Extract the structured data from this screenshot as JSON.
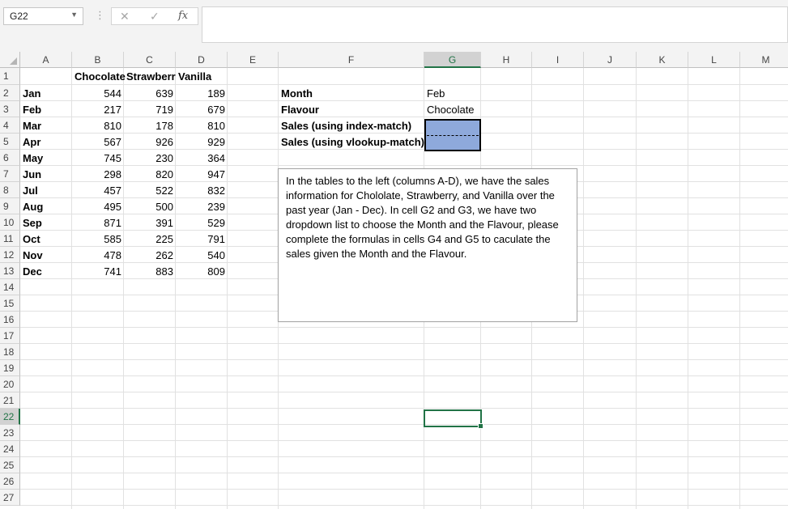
{
  "namebox": {
    "value": "G22",
    "dropdown_icon": "chevron-down-icon"
  },
  "formula_bar": {
    "cancel_icon": "cancel-x-icon",
    "confirm_icon": "checkmark-icon",
    "fx_label": "fx",
    "formula": ""
  },
  "columns": [
    "A",
    "B",
    "C",
    "D",
    "E",
    "F",
    "G",
    "H",
    "I",
    "J",
    "K",
    "L",
    "M"
  ],
  "selected_column": "G",
  "rows": [
    "1",
    "2",
    "3",
    "4",
    "5",
    "6",
    "7",
    "8",
    "9",
    "10",
    "11",
    "12",
    "13",
    "14",
    "15",
    "16",
    "17",
    "18",
    "19",
    "20",
    "21",
    "22",
    "23",
    "24",
    "25",
    "26",
    "27"
  ],
  "selected_row": "22",
  "table": {
    "headers": [
      "Chocolate",
      "Strawberr",
      "Vanilla"
    ],
    "months": [
      "Jan",
      "Feb",
      "Mar",
      "Apr",
      "May",
      "Jun",
      "Jul",
      "Aug",
      "Sep",
      "Oct",
      "Nov",
      "Dec"
    ],
    "values": [
      [
        544,
        639,
        189
      ],
      [
        217,
        719,
        679
      ],
      [
        810,
        178,
        810
      ],
      [
        567,
        926,
        929
      ],
      [
        745,
        230,
        364
      ],
      [
        298,
        820,
        947
      ],
      [
        457,
        522,
        832
      ],
      [
        495,
        500,
        239
      ],
      [
        871,
        391,
        529
      ],
      [
        585,
        225,
        791
      ],
      [
        478,
        262,
        540
      ],
      [
        741,
        883,
        809
      ]
    ]
  },
  "lookup": {
    "month_label": "Month",
    "month_value": "Feb",
    "flavour_label": "Flavour",
    "flavour_value": "Chocolate",
    "index_match_label": "Sales (using index-match)",
    "vlookup_match_label": "Sales (using vlookup-match)"
  },
  "colors": {
    "accent": "#217346",
    "result_fill": "#8ea9db"
  },
  "note": "In the tables to the left (columns A-D), we have the sales information for Chololate, Strawberry, and Vanilla over the past year (Jan - Dec). In cell G2 and G3, we have two dropdown list to choose the Month and the Flavour, please complete the formulas in cells G4 and G5 to caculate the sales given the Month and the Flavour."
}
